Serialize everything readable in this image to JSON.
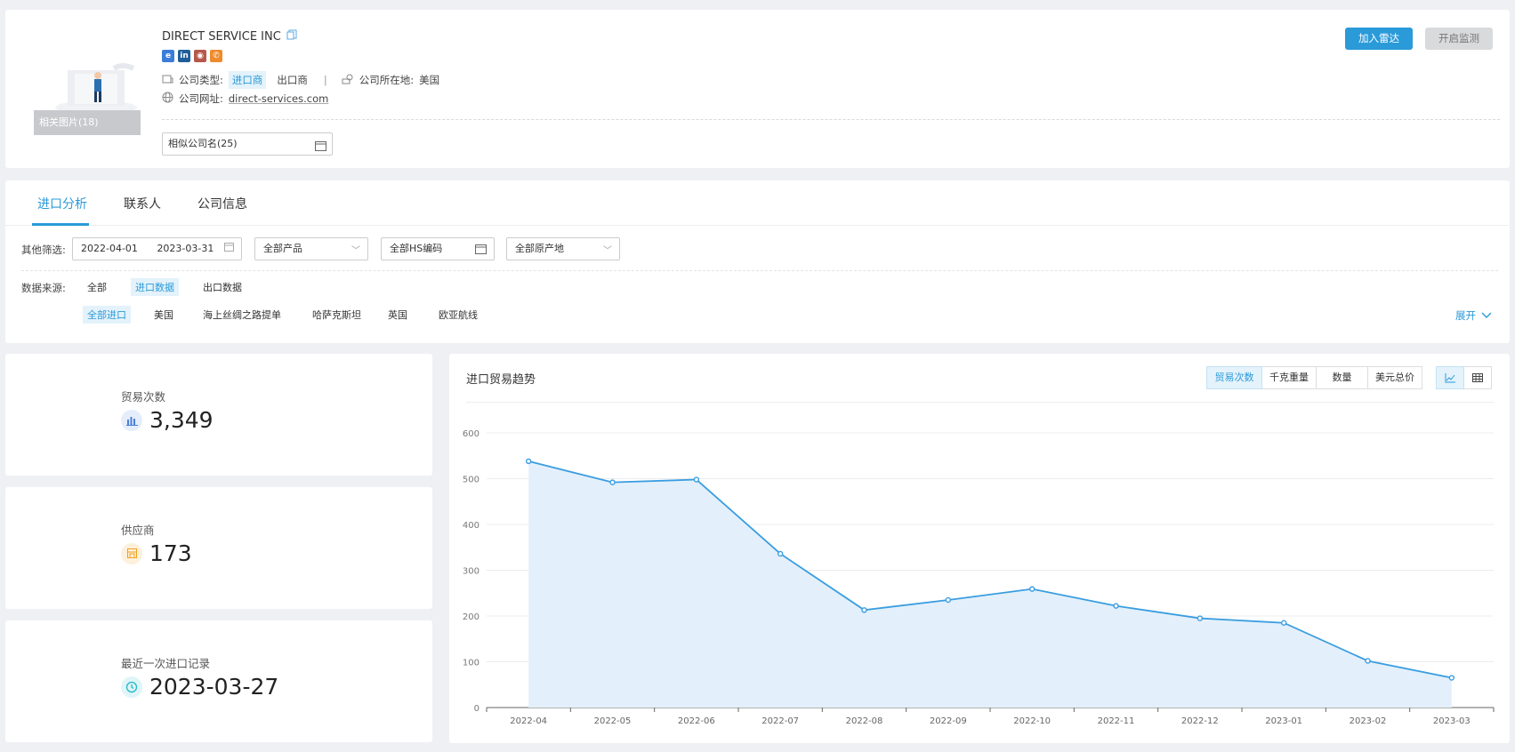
{
  "company": {
    "name": "DIRECT SERVICE INC",
    "photo_caption": "相关图片(18)",
    "type_label": "公司类型:",
    "type_tags": [
      "进口商",
      "出口商"
    ],
    "location_label": "公司所在地:",
    "location_value": "美国",
    "website_label": "公司网址:",
    "website_value": "direct-services.com",
    "similar_select": "相似公司名(25)",
    "social_icons": [
      "ie-icon",
      "linkedin-icon",
      "record-icon",
      "phone-icon"
    ]
  },
  "actions": {
    "add_radar": "加入雷达",
    "start_monitor": "开启监测"
  },
  "tabs": [
    {
      "label": "进口分析",
      "active": true
    },
    {
      "label": "联系人",
      "active": false
    },
    {
      "label": "公司信息",
      "active": false
    }
  ],
  "filters": {
    "other_label": "其他筛选:",
    "date_start": "2022-04-01",
    "date_end": "2023-03-31",
    "product": "全部产品",
    "hs_code": "全部HS编码",
    "origin": "全部原产地",
    "source_label": "数据来源:",
    "sources": [
      "全部",
      "进口数据",
      "出口数据"
    ],
    "active_source": "进口数据",
    "sub_sources": [
      "全部进口",
      "美国",
      "海上丝绸之路提单",
      "哈萨克斯坦",
      "英国",
      "欧亚航线"
    ],
    "active_sub_source": "全部进口",
    "expand": "展开"
  },
  "stats": [
    {
      "label": "贸易次数",
      "value": "3,349",
      "icon": "bar-chart-icon",
      "color": "#4a7fd6"
    },
    {
      "label": "供应商",
      "value": "173",
      "icon": "supplier-icon",
      "color": "#f0a020"
    },
    {
      "label": "最近一次进口记录",
      "value": "2023-03-27",
      "icon": "clock-icon",
      "color": "#22b8c8"
    }
  ],
  "chart_panel": {
    "title": "进口贸易趋势",
    "metrics": [
      "贸易次数",
      "千克重量",
      "数量",
      "美元总价"
    ],
    "active_metric": "贸易次数",
    "views": [
      "line-chart-icon",
      "table-icon"
    ]
  },
  "chart_data": {
    "type": "area",
    "x": [
      "2022-04",
      "2022-05",
      "2022-06",
      "2022-07",
      "2022-08",
      "2022-09",
      "2022-10",
      "2022-11",
      "2022-12",
      "2023-01",
      "2023-02",
      "2023-03"
    ],
    "series": [
      {
        "values": [
          538,
          492,
          498,
          336,
          213,
          235,
          259,
          222,
          195,
          185,
          102,
          65
        ]
      }
    ],
    "ylim": [
      0,
      600
    ],
    "yticks": [
      0,
      100,
      200,
      300,
      400,
      500,
      600
    ],
    "grid": true,
    "color": "#3a9de0",
    "fill": "#e3f0fb"
  }
}
